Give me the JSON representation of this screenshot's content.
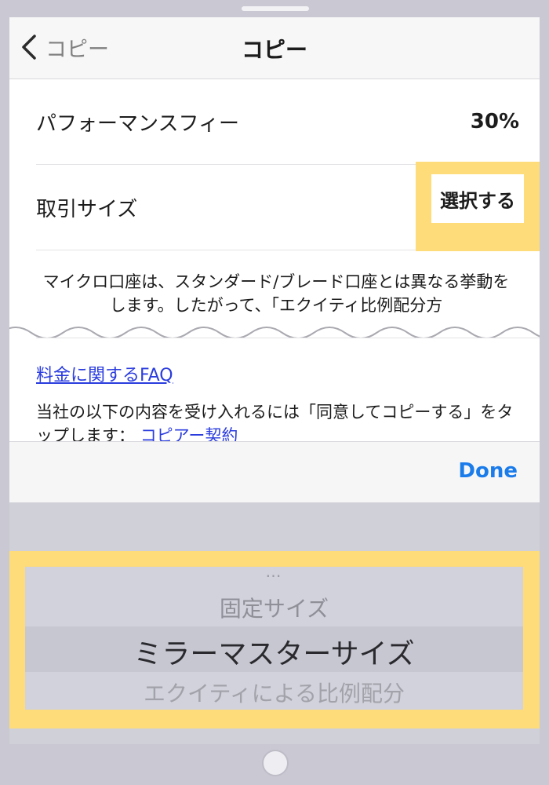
{
  "nav": {
    "back_label": "コピー",
    "title": "コピー"
  },
  "rows": [
    {
      "label": "パフォーマンスフィー",
      "value": "30%"
    },
    {
      "label": "取引サイズ",
      "button": "選択する"
    }
  ],
  "note": "マイクロ口座は、スタンダード/ブレード口座とは異なる挙動をします。したがって、「エクイティ比例配分方",
  "faq_link": "料金に関するFAQ",
  "terms": {
    "text": "当社の以下の内容を受け入れるには「同意してコピーする」をタップします：",
    "link": "コピアー契約"
  },
  "toolbar": {
    "done_label": "Done"
  },
  "picker": {
    "ellipsis": "…",
    "options": [
      "固定サイズ",
      "ミラーマスターサイズ",
      "エクイティによる比例配分"
    ],
    "selected": "ミラーマスターサイズ"
  },
  "colors": {
    "highlight": "#fedc7a",
    "link": "#2a3cde",
    "done": "#1a7bea"
  }
}
